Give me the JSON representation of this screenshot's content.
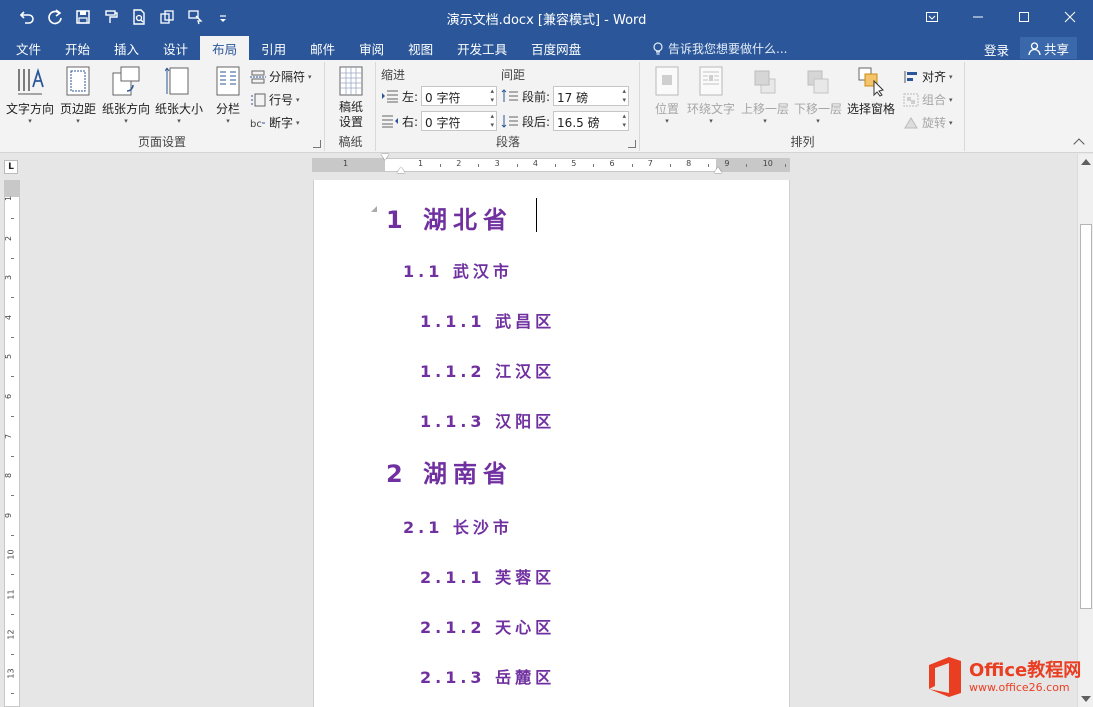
{
  "window": {
    "title": "演示文档.docx [兼容模式] - Word"
  },
  "quick_access": [
    {
      "name": "undo-icon"
    },
    {
      "name": "redo-icon"
    },
    {
      "name": "save-icon"
    },
    {
      "name": "format-painter-icon"
    },
    {
      "name": "print-preview-icon"
    },
    {
      "name": "copy-icon"
    },
    {
      "name": "touch-mode-icon"
    },
    {
      "name": "customize-qat-icon"
    }
  ],
  "tabs": [
    "文件",
    "开始",
    "插入",
    "设计",
    "布局",
    "引用",
    "邮件",
    "审阅",
    "视图",
    "开发工具",
    "百度网盘"
  ],
  "active_tab": "布局",
  "tell_me": "告诉我您想要做什么...",
  "login": "登录",
  "share": "共享",
  "ribbon": {
    "page_setup": {
      "label": "页面设置",
      "text_direction": "文字方向",
      "margins": "页边距",
      "orientation": "纸张方向",
      "size": "纸张大小",
      "columns": "分栏",
      "breaks": "分隔符",
      "line_numbers": "行号",
      "hyphenation": "断字"
    },
    "manuscript": {
      "label": "稿纸",
      "settings": "稿纸\n设置",
      "settings_line1": "稿纸",
      "settings_line2": "设置"
    },
    "paragraph": {
      "label": "段落",
      "indent_label": "缩进",
      "spacing_label": "间距",
      "left_label": "左:",
      "right_label": "右:",
      "before_label": "段前:",
      "after_label": "段后:",
      "left_value": "0 字符",
      "right_value": "0 字符",
      "before_value": "17 磅",
      "after_value": "16.5 磅"
    },
    "arrange": {
      "label": "排列",
      "position": "位置",
      "wrap_text": "环绕文字",
      "bring_forward": "上移一层",
      "send_backward": "下移一层",
      "selection_pane": "选择窗格",
      "align": "对齐",
      "group": "组合",
      "rotate": "旋转"
    }
  },
  "ruler": {
    "h_left_numbers": [
      "1"
    ],
    "h_numbers": [
      "1",
      "2",
      "3",
      "4",
      "5",
      "6",
      "7",
      "8",
      "9",
      "10"
    ],
    "v_numbers": [
      "1",
      "2",
      "3",
      "4",
      "5",
      "6",
      "7",
      "8",
      "9",
      "10",
      "11",
      "12",
      "13"
    ]
  },
  "document": {
    "headings": [
      {
        "level": 1,
        "text": "1 湖北省"
      },
      {
        "level": 2,
        "text": "1.1 武汉市"
      },
      {
        "level": 3,
        "text": "1.1.1 武昌区"
      },
      {
        "level": 3,
        "text": "1.1.2 江汉区"
      },
      {
        "level": 3,
        "text": "1.1.3 汉阳区"
      },
      {
        "level": 1,
        "text": "2 湖南省"
      },
      {
        "level": 2,
        "text": "2.1 长沙市"
      },
      {
        "level": 3,
        "text": "2.1.1 芙蓉区"
      },
      {
        "level": 3,
        "text": "2.1.2 天心区"
      },
      {
        "level": 3,
        "text": "2.1.3 岳麓区"
      }
    ],
    "heading_color": "#7030a0"
  },
  "watermark": {
    "line1": "Office教程网",
    "line2": "www.office26.com"
  },
  "colors": {
    "accent": "#2b579a"
  }
}
